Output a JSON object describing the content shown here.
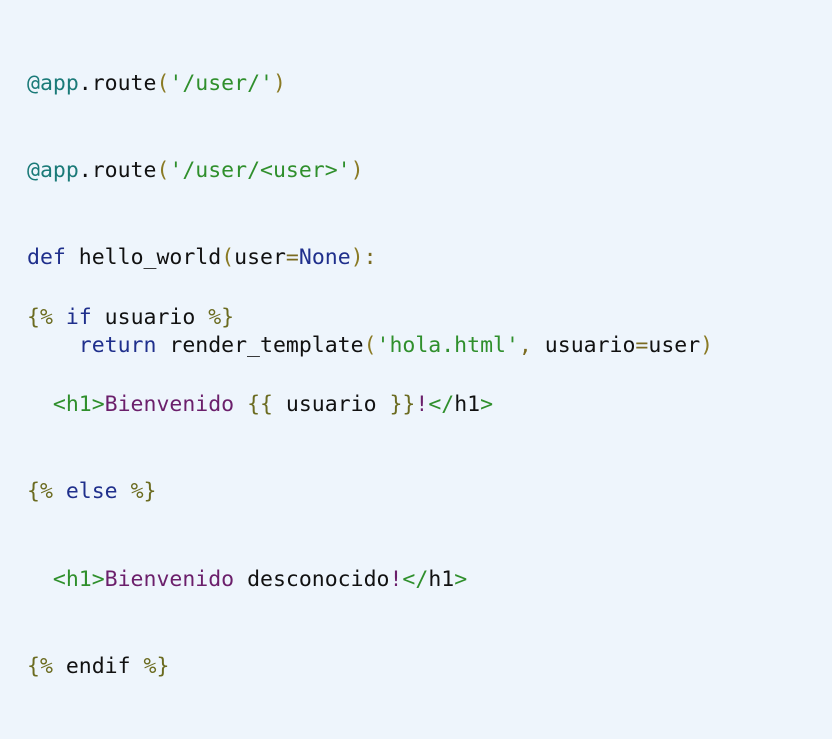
{
  "python_code": {
    "line1": {
      "decorator": "@app",
      "dot_method": ".route",
      "open": "(",
      "arg": "'/user/'",
      "close": ")"
    },
    "line2": {
      "decorator": "@app",
      "dot_method": ".route",
      "open": "(",
      "arg": "'/user/<user>'",
      "close": ")"
    },
    "line3": {
      "keyword": "def",
      "func_name": " hello_world",
      "open": "(",
      "param": "user",
      "eq": "=",
      "default": "None",
      "close": ")",
      "colon": ":"
    },
    "line4": {
      "indent": "    ",
      "keyword": "return",
      "call": " render_template",
      "open": "(",
      "arg1": "'hola.html'",
      "comma": ",",
      "kwarg": " usuario",
      "eq": "=",
      "value": "user",
      "close": ")"
    }
  },
  "template_code": {
    "line1": {
      "open": "{%",
      "keyword": " if",
      "var": " usuario",
      "close": " %}"
    },
    "line2": {
      "indent": "  ",
      "tag_open": "<h1>",
      "text": "Bienvenido",
      "expr_open": " {{",
      "expr_var": " usuario",
      "expr_close": " }}",
      "bang": "!",
      "tag_close_lt": "</",
      "tag_close_name": "h1",
      "tag_close_gt": ">"
    },
    "line3": {
      "open": "{%",
      "keyword": " else",
      "close": " %}"
    },
    "line4": {
      "indent": "  ",
      "tag_open": "<h1>",
      "text": "Bienvenido",
      "word": " desconocido",
      "bang": "!",
      "tag_close_lt": "</",
      "tag_close_name": "h1",
      "tag_close_gt": ">"
    },
    "line5": {
      "open": "{%",
      "keyword": " endif",
      "close": " %}"
    }
  },
  "colors": {
    "background": "#eef5fc",
    "decorator": "#1a7a78",
    "string": "#2f8f2c",
    "keyword": "#1f2f8c",
    "delimiter": "#6b6b20",
    "text_purple": "#6b1f6b"
  }
}
